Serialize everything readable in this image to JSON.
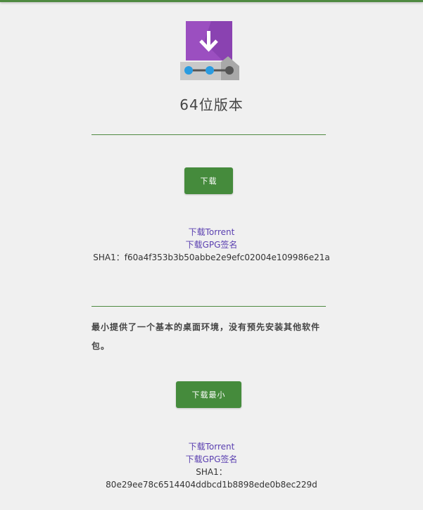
{
  "edition": {
    "title": "64位版本",
    "download_label": "下载",
    "torrent_link": "下载Torrent",
    "gpg_link": "下载GPG签名",
    "sha1": "SHA1：f60a4f353b3b50abbe2e9efc02004e109986e21a"
  },
  "minimal": {
    "description": "最小提供了一个基本的桌面环境，没有预先安装其他软件包。",
    "download_label": "下载最小",
    "torrent_link": "下载Torrent",
    "gpg_link": "下载GPG签名",
    "sha1_label": "SHA1：",
    "sha1_value": "80e29ee78c6514404ddbcd1b8898ede0b8ec229d"
  },
  "icons": {
    "logo": "download-installer-icon"
  },
  "colors": {
    "accent": "#458b3c",
    "link": "#5a3fb0"
  }
}
